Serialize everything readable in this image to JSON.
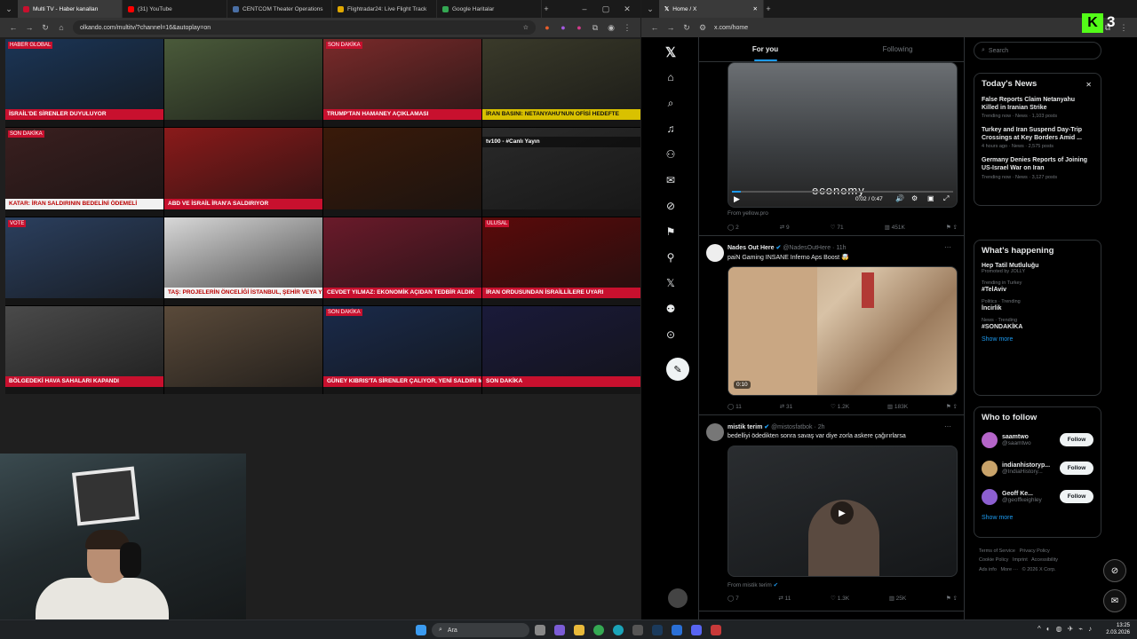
{
  "left_browser": {
    "tabs": [
      {
        "label": "Multi TV - Haber kanalları",
        "color": "#c8102e"
      },
      {
        "label": "(31) YouTube",
        "color": "#ff0000"
      },
      {
        "label": "CENTCOM Theater Operations",
        "color": "#4a6fa5"
      },
      {
        "label": "Flightradar24: Live Flight Track",
        "color": "#e0a800"
      },
      {
        "label": "Google Haritalar",
        "color": "#34a853"
      }
    ],
    "url": "olkando.com/multitv/?channel=16&autoplay=on"
  },
  "tv_grid": [
    {
      "ticker": "İSRAİL'DE SİRENLER DUYULUYOR",
      "style": "red",
      "label": "HABER GLOBAL"
    },
    {
      "ticker": "",
      "style": "none",
      "label": ""
    },
    {
      "ticker": "TRUMP'TAN HAMANEY AÇIKLAMASI",
      "style": "red",
      "label": "SON DAKİKA"
    },
    {
      "ticker": "İRAN BASINI: NETANYAHU'NUN OFİSİ HEDEFTE",
      "style": "yellow",
      "label": ""
    },
    {
      "ticker": "KATAR: İRAN SALDIRININ BEDELİNİ ÖDEMELİ",
      "style": "white",
      "label": "SON DAKİKA"
    },
    {
      "ticker": "ABD VE İSRAİL İRAN'A SALDIRIYOR",
      "style": "red",
      "label": ""
    },
    {
      "ticker": "",
      "style": "none",
      "label": ""
    },
    {
      "ticker": "tv100 - #Canlı Yayın",
      "style": "none",
      "label": ""
    },
    {
      "ticker": "",
      "style": "none",
      "label": "VOTE"
    },
    {
      "ticker": "TAŞ: PROJELERİN ÖNCELİĞİ İSTANBUL, ŞEHİR VEYA YURT DIŞINDAN TEKLİFLERİ DEĞERLENDİREBİLİRİZ",
      "style": "white",
      "label": ""
    },
    {
      "ticker": "CEVDET YILMAZ: EKONOMİK AÇIDAN TEDBİR ALDIK",
      "style": "red",
      "label": ""
    },
    {
      "ticker": "İRAN ORDUSUNDAN İSRAİLLİLERE UYARI",
      "style": "red",
      "label": "ULUSAL"
    },
    {
      "ticker": "BÖLGEDEKİ HAVA SAHALARI KAPANDI",
      "style": "red",
      "label": ""
    },
    {
      "ticker": "",
      "style": "none",
      "label": ""
    },
    {
      "ticker": "GÜNEY KIBRIS'TA SİRENLER ÇALIYOR, YENİ SALDIRI Mİ?",
      "style": "red",
      "label": "SON DAKİKA"
    },
    {
      "ticker": "SON DAKİKA",
      "style": "red",
      "label": ""
    }
  ],
  "right_browser": {
    "tab": "Home / X",
    "url": "x.com/home",
    "feed_tabs": [
      "For you",
      "Following"
    ],
    "search_placeholder": "Search",
    "posts": [
      {
        "source": "From yellow.pro",
        "video_time": "0:02 / 0:47",
        "overlay": "economy",
        "actions": [
          "2",
          "9",
          "71",
          "451K"
        ]
      },
      {
        "name": "Nades Out Here",
        "handle": "@NadesOutHere · 11h",
        "text": "paiN Gaming INSANE Inferno Aps Boost 🤯",
        "video_time": "0:10",
        "actions": [
          "11",
          "31",
          "1.2K",
          "183K"
        ]
      },
      {
        "name": "mistik terim",
        "handle": "@mistosfatbok · 2h",
        "text": "bedelliyi ödedikten sonra savaş var diye zorla askere çağırırlarsa",
        "source": "From mistik terim",
        "actions": [
          "7",
          "11",
          "1.3K",
          "25K"
        ]
      }
    ],
    "todays_news": {
      "title": "Today's News",
      "items": [
        {
          "title": "False Reports Claim Netanyahu Killed in Iranian Strike",
          "meta": "Trending now · News · 1,103 posts"
        },
        {
          "title": "Turkey and Iran Suspend Day-Trip Crossings at Key Borders Amid ...",
          "meta": "4 hours ago · News · 2,575 posts"
        },
        {
          "title": "Germany Denies Reports of Joining US-Israel War on Iran",
          "meta": "Trending now · News · 3,127 posts"
        }
      ]
    },
    "whats_happening": {
      "title": "What's happening",
      "items": [
        {
          "context": "",
          "name": "Hep Tatil Mutluluğu",
          "sub": "Promoted by JOLLY"
        },
        {
          "context": "Trending in Turkey",
          "name": "#TelAviv",
          "sub": ""
        },
        {
          "context": "Politics · Trending",
          "name": "İncirlik",
          "sub": ""
        },
        {
          "context": "News · Trending",
          "name": "#SONDAKİKA",
          "sub": ""
        }
      ],
      "show_more": "Show more"
    },
    "who_to_follow": {
      "title": "Who to follow",
      "users": [
        {
          "name": "saamtwo",
          "handle": "@saamtwo",
          "color": "#b565c9"
        },
        {
          "name": "indianhistoryp...",
          "handle": "@IndiaHistory...",
          "color": "#c9a36a"
        },
        {
          "name": "Geoff Ke...",
          "handle": "@geoffkeighley",
          "color": "#8c5fd0"
        }
      ],
      "follow_label": "Follow",
      "show_more": "Show more"
    },
    "footer": [
      "Terms of Service",
      "Privacy Policy",
      "Cookie Policy",
      "Imprint",
      "Accessibility",
      "Ads info",
      "More ···",
      "© 2026 X Corp."
    ]
  },
  "taskbar": {
    "search_placeholder": "Ara",
    "time": "13:25",
    "date": "2.03.2026"
  },
  "kick_badge": "3"
}
